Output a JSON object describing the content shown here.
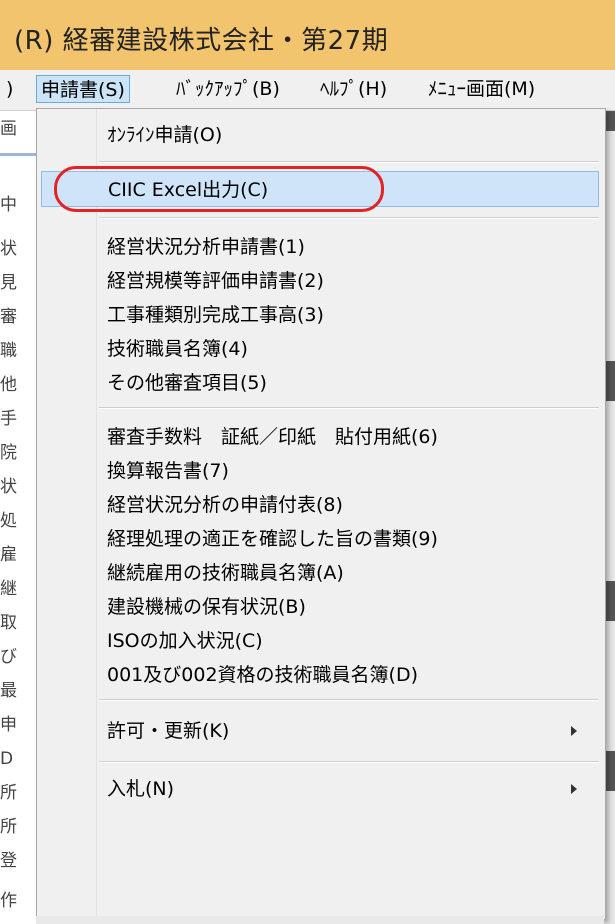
{
  "window": {
    "title": "(R) 経審建設株式会社・第27期"
  },
  "menubar": {
    "items": [
      {
        "label": ")"
      },
      {
        "label": "申請書(S)"
      },
      {
        "label": "ﾊﾞｯｸｱｯﾌﾟ(B)"
      },
      {
        "label": "ﾍﾙﾌﾟ(H)"
      },
      {
        "label": "ﾒﾆｭｰ画面(M)"
      }
    ]
  },
  "background_fragments": [
    "画",
    "中",
    "状",
    "見",
    "審",
    "職",
    "他",
    "手",
    "院",
    "状",
    "処",
    "雇",
    "継",
    "取",
    "び",
    "最",
    "申",
    "D",
    "所",
    "所",
    "登",
    "作"
  ],
  "menu": {
    "items": [
      {
        "label": "ｵﾝﾗｲﾝ申請(O)"
      },
      {
        "label": "CIIC Excel出力(C)"
      },
      {
        "label": "経営状況分析申請書(1)"
      },
      {
        "label": "経営規模等評価申請書(2)"
      },
      {
        "label": "工事種類別完成工事高(3)"
      },
      {
        "label": "技術職員名簿(4)"
      },
      {
        "label": "その他審査項目(5)"
      },
      {
        "label": "審査手数料　証紙／印紙　貼付用紙(6)"
      },
      {
        "label": "換算報告書(7)"
      },
      {
        "label": "経営状況分析の申請付表(8)"
      },
      {
        "label": "経理処理の適正を確認した旨の書類(9)"
      },
      {
        "label": "継続雇用の技術職員名簿(A)"
      },
      {
        "label": "建設機械の保有状況(B)"
      },
      {
        "label": "ISOの加入状況(C)"
      },
      {
        "label": "001及び002資格の技術職員名簿(D)"
      },
      {
        "label": "許可・更新(K)"
      },
      {
        "label": "入札(N)"
      }
    ]
  },
  "colors": {
    "titlebar": "#f3c46e",
    "highlight": "#cfe4f8",
    "annotation": "#e32323"
  }
}
